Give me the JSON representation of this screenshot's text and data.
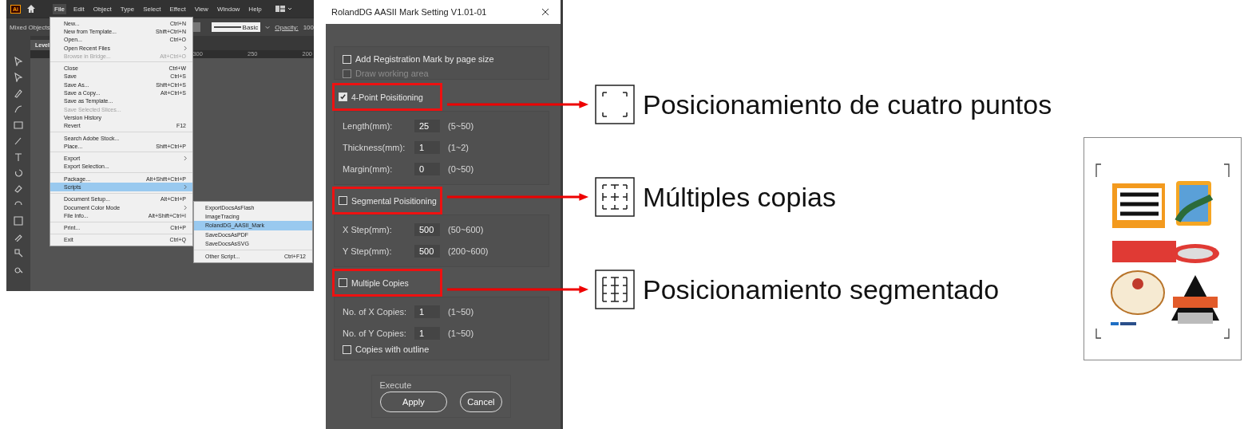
{
  "illustrator": {
    "app_logo": "Ai",
    "menu_bar": [
      {
        "label": "File",
        "selected": true
      },
      {
        "label": "Edit",
        "selected": false
      },
      {
        "label": "Object",
        "selected": false
      },
      {
        "label": "Type",
        "selected": false
      },
      {
        "label": "Select",
        "selected": false
      },
      {
        "label": "Effect",
        "selected": false
      },
      {
        "label": "View",
        "selected": false
      },
      {
        "label": "Window",
        "selected": false
      },
      {
        "label": "Help",
        "selected": false
      }
    ],
    "control_bar": {
      "selection": "Mixed Objects",
      "stroke_style": "Basic",
      "opacity_label": "Opacity:",
      "opacity_value": "100"
    },
    "document_tab": "Level",
    "ruler_labels": [
      "300",
      "250",
      "200"
    ],
    "file_menu": [
      {
        "items": [
          {
            "label": "New...",
            "shortcut": "Ctrl+N",
            "submenu": false,
            "disabled": false,
            "selected": false
          },
          {
            "label": "New from Template...",
            "shortcut": "Shift+Ctrl+N",
            "submenu": false,
            "disabled": false,
            "selected": false
          },
          {
            "label": "Open...",
            "shortcut": "Ctrl+O",
            "submenu": false,
            "disabled": false,
            "selected": false
          },
          {
            "label": "Open Recent Files",
            "submenu": true,
            "disabled": false,
            "selected": false
          },
          {
            "label": "Browse in Bridge...",
            "shortcut": "Alt+Ctrl+O",
            "submenu": false,
            "disabled": true,
            "selected": false
          }
        ]
      },
      {
        "items": [
          {
            "label": "Close",
            "shortcut": "Ctrl+W",
            "submenu": false,
            "disabled": false,
            "selected": false
          },
          {
            "label": "Save",
            "shortcut": "Ctrl+S",
            "submenu": false,
            "disabled": false,
            "selected": false
          },
          {
            "label": "Save As...",
            "shortcut": "Shift+Ctrl+S",
            "submenu": false,
            "disabled": false,
            "selected": false
          },
          {
            "label": "Save a Copy...",
            "shortcut": "Alt+Ctrl+S",
            "submenu": false,
            "disabled": false,
            "selected": false
          },
          {
            "label": "Save as Template...",
            "submenu": false,
            "disabled": false,
            "selected": false
          },
          {
            "label": "Save Selected Slices...",
            "submenu": false,
            "disabled": true,
            "selected": false
          },
          {
            "label": "Version History",
            "submenu": false,
            "disabled": false,
            "selected": false
          },
          {
            "label": "Revert",
            "shortcut": "F12",
            "submenu": false,
            "disabled": false,
            "selected": false
          }
        ]
      },
      {
        "items": [
          {
            "label": "Search Adobe Stock...",
            "submenu": false,
            "disabled": false,
            "selected": false
          },
          {
            "label": "Place...",
            "shortcut": "Shift+Ctrl+P",
            "submenu": false,
            "disabled": false,
            "selected": false
          }
        ]
      },
      {
        "items": [
          {
            "label": "Export",
            "submenu": true,
            "disabled": false,
            "selected": false
          },
          {
            "label": "Export Selection...",
            "submenu": false,
            "disabled": false,
            "selected": false
          }
        ]
      },
      {
        "items": [
          {
            "label": "Package...",
            "shortcut": "Alt+Shift+Ctrl+P",
            "submenu": false,
            "disabled": false,
            "selected": false
          },
          {
            "label": "Scripts",
            "submenu": true,
            "disabled": false,
            "selected": true
          }
        ]
      },
      {
        "items": [
          {
            "label": "Document Setup...",
            "shortcut": "Alt+Ctrl+P",
            "submenu": false,
            "disabled": false,
            "selected": false
          },
          {
            "label": "Document Color Mode",
            "submenu": true,
            "disabled": false,
            "selected": false
          },
          {
            "label": "File Info...",
            "shortcut": "Alt+Shift+Ctrl+I",
            "submenu": false,
            "disabled": false,
            "selected": false
          }
        ]
      },
      {
        "items": [
          {
            "label": "Print...",
            "shortcut": "Ctrl+P",
            "submenu": false,
            "disabled": false,
            "selected": false
          }
        ]
      },
      {
        "items": [
          {
            "label": "Exit",
            "shortcut": "Ctrl+Q",
            "submenu": false,
            "disabled": false,
            "selected": false
          }
        ]
      }
    ],
    "scripts_submenu": [
      {
        "items": [
          {
            "label": "ExportDocsAsFlash",
            "selected": false
          },
          {
            "label": "ImageTracing",
            "selected": false
          },
          {
            "label": "RolandDG_AASII_Mark",
            "selected": true
          },
          {
            "label": "SaveDocsAsPDF",
            "selected": false
          },
          {
            "label": "SaveDocsAsSVG",
            "selected": false
          }
        ]
      },
      {
        "items": [
          {
            "label": "Other Script...",
            "shortcut": "Ctrl+F12",
            "selected": false
          }
        ]
      }
    ]
  },
  "dialog": {
    "title": "RolandDG AASII Mark Setting V1.01-01",
    "page_size_options": [
      {
        "label": "Add Registration Mark by page size",
        "checked": false,
        "disabled": false
      },
      {
        "label": "Draw working area",
        "checked": false,
        "disabled": true
      }
    ],
    "sections": [
      {
        "label": "4-Point Poisitioning",
        "checked": true,
        "fields": [
          {
            "label": "Length(mm):",
            "value": "25",
            "range": "(5~50)"
          },
          {
            "label": "Thickness(mm):",
            "value": "1",
            "range": "(1~2)"
          },
          {
            "label": "Margin(mm):",
            "value": "0",
            "range": "(0~50)"
          }
        ]
      },
      {
        "label": "Segmental Poisitioning",
        "checked": false,
        "fields": [
          {
            "label": "X Step(mm):",
            "value": "500",
            "range": "(50~600)"
          },
          {
            "label": "Y Step(mm):",
            "value": "500",
            "range": "(200~600)"
          }
        ]
      },
      {
        "label": "Multiple Copies",
        "checked": false,
        "fields": [
          {
            "label": "No. of X Copies:",
            "value": "1",
            "range": "(1~50)"
          },
          {
            "label": "No. of Y Copies:",
            "value": "1",
            "range": "(1~50)"
          }
        ],
        "options": [
          {
            "label": "Copies with outline",
            "checked": false
          }
        ]
      }
    ],
    "execute": {
      "legend": "Execute",
      "buttons": [
        "Apply",
        "Cancel"
      ]
    }
  },
  "annotations": [
    {
      "text": "Posicionamiento de cuatro puntos",
      "kind": "four-point"
    },
    {
      "text": "Múltiples copias",
      "kind": "segmental"
    },
    {
      "text": "Posicionamiento segmentado",
      "kind": "multiple"
    }
  ]
}
